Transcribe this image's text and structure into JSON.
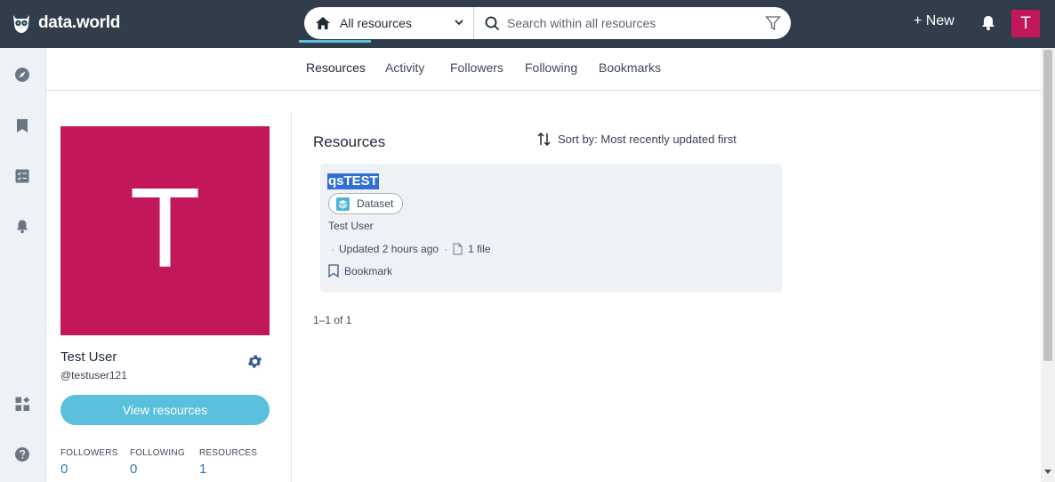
{
  "brand": {
    "name": "data.world"
  },
  "search": {
    "scope_label": "All resources",
    "placeholder": "Search within all resources"
  },
  "topbar": {
    "new_label": "+ New",
    "avatar_letter": "T"
  },
  "tabs": [
    {
      "label": "Resources",
      "active": true
    },
    {
      "label": "Activity"
    },
    {
      "label": "Followers"
    },
    {
      "label": "Following"
    },
    {
      "label": "Bookmarks"
    }
  ],
  "profile": {
    "avatar_letter": "T",
    "name": "Test User",
    "handle": "@testuser121",
    "view_resources_label": "View resources",
    "stats": [
      {
        "label": "FOLLOWERS",
        "value": "0"
      },
      {
        "label": "FOLLOWING",
        "value": "0"
      },
      {
        "label": "RESOURCES",
        "value": "1"
      }
    ]
  },
  "resources": {
    "heading": "Resources",
    "sort_label": "Sort by: Most recently updated first",
    "items": [
      {
        "title": "qsTEST",
        "type_label": "Dataset",
        "owner": "Test User",
        "updated": "Updated 2 hours ago",
        "files": "1 file",
        "bookmark_label": "Bookmark"
      }
    ],
    "pagination": "1–1 of 1"
  },
  "colors": {
    "topbar": "#323d4c",
    "accent": "#5bc0de",
    "avatar": "#c2185b",
    "link": "#2b7bb9"
  }
}
